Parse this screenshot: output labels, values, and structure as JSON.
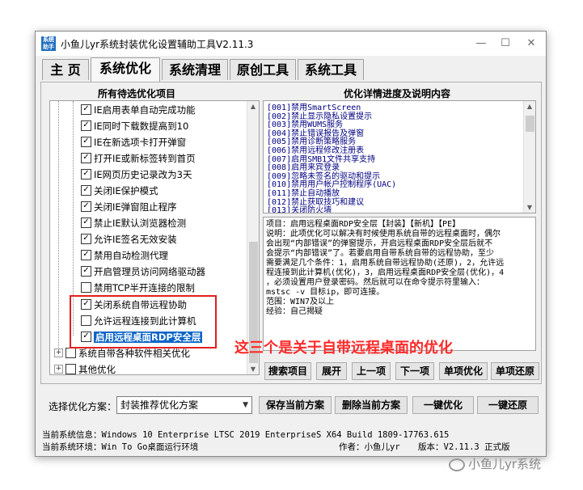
{
  "window": {
    "title": "小鱼儿yr系统封装优化设置辅助工具V2.11.3",
    "icon_text": "系统助手",
    "buttons": {
      "minimize": "—",
      "maximize": "☐",
      "close": "✕"
    }
  },
  "tabs": [
    "主 页",
    "系统优化",
    "系统清理",
    "原创工具",
    "系统工具"
  ],
  "active_tab": "系统优化",
  "left_panel": {
    "heading": "所有待选优化项目",
    "items": [
      {
        "label": "IE启用表单自动完成功能",
        "checked": true
      },
      {
        "label": "IE同时下载数提高到10",
        "checked": true
      },
      {
        "label": "IE在新选项卡打开弹窗",
        "checked": true
      },
      {
        "label": "打开IE或新标签转到首页",
        "checked": true
      },
      {
        "label": "IE网页历史记录改为3天",
        "checked": true
      },
      {
        "label": "关闭IE保护模式",
        "checked": true
      },
      {
        "label": "关闭IE弹窗阻止程序",
        "checked": true
      },
      {
        "label": "禁止IE默认浏览器检测",
        "checked": true
      },
      {
        "label": "允许IE签名无效安装",
        "checked": true
      },
      {
        "label": "禁用自动检测代理",
        "checked": true
      },
      {
        "label": "开启管理员访问网络驱动器",
        "checked": true
      },
      {
        "label": "禁用TCP半开连接的限制",
        "checked": false
      },
      {
        "label": "关闭系统自带远程协助",
        "checked": true
      },
      {
        "label": "允许远程连接到此计算机",
        "checked": false
      },
      {
        "label": "启用远程桌面RDP安全层",
        "checked": true,
        "selected": true
      }
    ],
    "groups": [
      {
        "label": "系统自带各种软件相关优化",
        "checked": false
      },
      {
        "label": "其他优化",
        "checked": false
      }
    ]
  },
  "annotation": "这三个是关于自带远程桌面的优化",
  "right_panel": {
    "heading": "优化详情进度及说明内容",
    "list": [
      "[001]禁用SmartScreen",
      "[002]禁止显示隐私设置提示",
      "[003]禁用WUMS服务",
      "[004]禁止错误报告及弹窗",
      "[005]禁用诊断策略服务",
      "[006]禁用远程修改注册表",
      "[007]启用SMB1文件共享支持",
      "[008]启用来宾登录",
      "[009]忽略未签名的驱动和提示",
      "[010]禁用用户帐户控制程序(UAC)",
      "[011]禁止自动播放",
      "[012]禁止获取技巧和建议",
      "[013]关闭防火墙"
    ],
    "description": [
      "项目：启用远程桌面RDP安全层【封装】【新机】【PE】",
      "说明：此项优化可以解决有时候使用系统自带的远程桌面时，偶尔",
      "会出现“内部错误”的弹窗提示，开启远程桌面RDP安全层后就不",
      "会提示“内部错误”了。若要启用自带系统自带的远程协助，至少",
      "需要满足几个条件：1，启用系统自带远程协助(还原)，2，允许远",
      "程连接到此计算机(优化)，3，启用远程桌面RDP安全层(优化)，4",
      "，必须设置用户登录密码。然后就可以在命令提示符里输入：",
      "mstsc -v 目标ip，即可连接。",
      "范围：WIN7及以上",
      "经验：自己揭疑"
    ],
    "buttons": [
      "搜索项目",
      "展开",
      "上一项",
      "下一项",
      "单项优化",
      "单项还原"
    ]
  },
  "bottom": {
    "scheme_label": "选择优化方案：",
    "scheme_value": "封装推荐优化方案",
    "buttons": [
      "保存当前方案",
      "删除当前方案",
      "一键优化",
      "一键还原"
    ]
  },
  "status": {
    "line1": "当前系统信息：Windows 10 Enterprise LTSC 2019 EnterpriseS X64 Build 1809-17763.615",
    "line2": "当前系统环境：Win To Go桌面运行环境",
    "author": "作者：小鱼儿yr",
    "version": "版本：V2.11.3 正式版"
  },
  "watermark": "小鱼儿yr系统",
  "colors": {
    "selection": "#0a64c8",
    "annotation": "#ff2a2a",
    "list_text": "#000080"
  }
}
